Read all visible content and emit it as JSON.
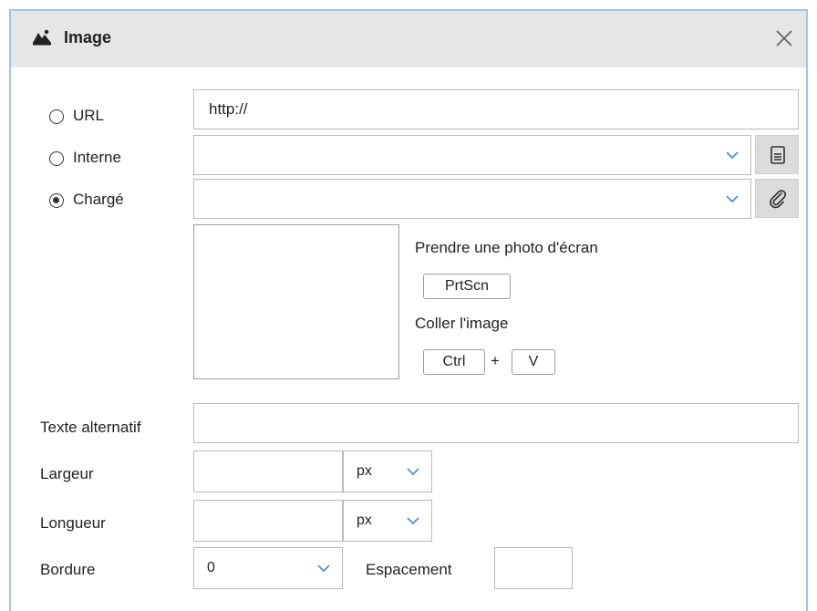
{
  "dialog": {
    "title": "Image",
    "icon": "image-icon",
    "close_icon": "close-icon"
  },
  "source": {
    "url": {
      "label": "URL",
      "value": "http://",
      "checked": false
    },
    "interne": {
      "label": "Interne",
      "value": "",
      "checked": false,
      "button_icon": "document-icon"
    },
    "charge": {
      "label": "Chargé",
      "value": "",
      "checked": true,
      "button_icon": "paperclip-icon"
    }
  },
  "capture": {
    "screenshot_label": "Prendre une photo d'écran",
    "screenshot_key": "PrtScn",
    "paste_label": "Coller l'image",
    "paste_key_1": "Ctrl",
    "paste_plus": "+",
    "paste_key_2": "V"
  },
  "form": {
    "alt_text": {
      "label": "Texte alternatif",
      "value": ""
    },
    "width": {
      "label": "Largeur",
      "value": "",
      "unit": "px"
    },
    "height": {
      "label": "Longueur",
      "value": "",
      "unit": "px"
    },
    "border": {
      "label": "Bordure",
      "value": "0"
    },
    "spacing": {
      "label": "Espacement",
      "value": ""
    }
  },
  "colors": {
    "accent": "#4a90d9",
    "titlebar": "#e6e6e6",
    "dialog_border": "#9fc6ea"
  }
}
